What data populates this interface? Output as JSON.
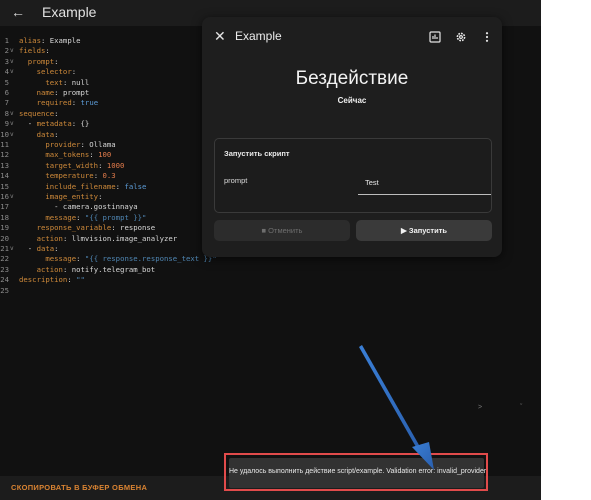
{
  "topbar": {
    "title": "Example",
    "back_icon": "arrow-left-icon"
  },
  "editor": {
    "lines": [
      {
        "num": "1",
        "fold": "",
        "parts": [
          {
            "c": "k",
            "t": "alias"
          },
          {
            "c": "v",
            "t": ": Example"
          }
        ]
      },
      {
        "num": "2",
        "fold": "v",
        "parts": [
          {
            "c": "k",
            "t": "fields"
          },
          {
            "c": "v",
            "t": ":"
          }
        ]
      },
      {
        "num": "3",
        "fold": "v",
        "parts": [
          {
            "c": "v",
            "t": "  "
          },
          {
            "c": "k",
            "t": "prompt"
          },
          {
            "c": "v",
            "t": ":"
          }
        ]
      },
      {
        "num": "4",
        "fold": "v",
        "parts": [
          {
            "c": "v",
            "t": "    "
          },
          {
            "c": "k",
            "t": "selector"
          },
          {
            "c": "v",
            "t": ":"
          }
        ]
      },
      {
        "num": "5",
        "fold": "",
        "parts": [
          {
            "c": "v",
            "t": "      "
          },
          {
            "c": "k",
            "t": "text"
          },
          {
            "c": "v",
            "t": ": null"
          }
        ]
      },
      {
        "num": "6",
        "fold": "",
        "parts": [
          {
            "c": "v",
            "t": "    "
          },
          {
            "c": "k",
            "t": "name"
          },
          {
            "c": "v",
            "t": ": prompt"
          }
        ]
      },
      {
        "num": "7",
        "fold": "",
        "parts": [
          {
            "c": "v",
            "t": "    "
          },
          {
            "c": "k",
            "t": "required"
          },
          {
            "c": "v",
            "t": ": "
          },
          {
            "c": "b",
            "t": "true"
          }
        ]
      },
      {
        "num": "8",
        "fold": "v",
        "parts": [
          {
            "c": "k",
            "t": "sequence"
          },
          {
            "c": "v",
            "t": ":"
          }
        ]
      },
      {
        "num": "9",
        "fold": "v",
        "parts": [
          {
            "c": "v",
            "t": "  - "
          },
          {
            "c": "k",
            "t": "metadata"
          },
          {
            "c": "v",
            "t": ": {}"
          }
        ]
      },
      {
        "num": "10",
        "fold": "v",
        "parts": [
          {
            "c": "v",
            "t": "    "
          },
          {
            "c": "k",
            "t": "data"
          },
          {
            "c": "v",
            "t": ":"
          }
        ]
      },
      {
        "num": "11",
        "fold": "",
        "parts": [
          {
            "c": "v",
            "t": "      "
          },
          {
            "c": "k",
            "t": "provider"
          },
          {
            "c": "v",
            "t": ": Ollama"
          }
        ]
      },
      {
        "num": "12",
        "fold": "",
        "parts": [
          {
            "c": "v",
            "t": "      "
          },
          {
            "c": "k",
            "t": "max_tokens"
          },
          {
            "c": "v",
            "t": ": "
          },
          {
            "c": "m",
            "t": "100"
          }
        ]
      },
      {
        "num": "13",
        "fold": "",
        "parts": [
          {
            "c": "v",
            "t": "      "
          },
          {
            "c": "k",
            "t": "target_width"
          },
          {
            "c": "v",
            "t": ": "
          },
          {
            "c": "m",
            "t": "1000"
          }
        ]
      },
      {
        "num": "14",
        "fold": "",
        "parts": [
          {
            "c": "v",
            "t": "      "
          },
          {
            "c": "k",
            "t": "temperature"
          },
          {
            "c": "v",
            "t": ": "
          },
          {
            "c": "m",
            "t": "0.3"
          }
        ]
      },
      {
        "num": "15",
        "fold": "",
        "parts": [
          {
            "c": "v",
            "t": "      "
          },
          {
            "c": "k",
            "t": "include_filename"
          },
          {
            "c": "v",
            "t": ": "
          },
          {
            "c": "b",
            "t": "false"
          }
        ]
      },
      {
        "num": "16",
        "fold": "v",
        "parts": [
          {
            "c": "v",
            "t": "      "
          },
          {
            "c": "k",
            "t": "image_entity"
          },
          {
            "c": "v",
            "t": ":"
          }
        ]
      },
      {
        "num": "17",
        "fold": "",
        "parts": [
          {
            "c": "v",
            "t": "        - camera.gostinnaya"
          }
        ]
      },
      {
        "num": "18",
        "fold": "",
        "parts": [
          {
            "c": "v",
            "t": "      "
          },
          {
            "c": "k",
            "t": "message"
          },
          {
            "c": "v",
            "t": ": "
          },
          {
            "c": "s",
            "t": "\"{{ prompt }}\""
          }
        ]
      },
      {
        "num": "19",
        "fold": "",
        "parts": [
          {
            "c": "v",
            "t": "    "
          },
          {
            "c": "k",
            "t": "response_variable"
          },
          {
            "c": "v",
            "t": ": response"
          }
        ]
      },
      {
        "num": "20",
        "fold": "",
        "parts": [
          {
            "c": "v",
            "t": "    "
          },
          {
            "c": "k",
            "t": "action"
          },
          {
            "c": "v",
            "t": ": llmvision.image_analyzer"
          }
        ]
      },
      {
        "num": "21",
        "fold": "v",
        "parts": [
          {
            "c": "v",
            "t": "  - "
          },
          {
            "c": "k",
            "t": "data"
          },
          {
            "c": "v",
            "t": ":"
          }
        ]
      },
      {
        "num": "22",
        "fold": "",
        "parts": [
          {
            "c": "v",
            "t": "      "
          },
          {
            "c": "k",
            "t": "message"
          },
          {
            "c": "v",
            "t": ": "
          },
          {
            "c": "s",
            "t": "\"{{ response.response_text }}\""
          }
        ]
      },
      {
        "num": "23",
        "fold": "",
        "parts": [
          {
            "c": "v",
            "t": "    "
          },
          {
            "c": "k",
            "t": "action"
          },
          {
            "c": "v",
            "t": ": notify.telegram_bot"
          }
        ]
      },
      {
        "num": "24",
        "fold": "",
        "parts": [
          {
            "c": "k",
            "t": "description"
          },
          {
            "c": "v",
            "t": ": "
          },
          {
            "c": "s",
            "t": "\"\""
          }
        ]
      },
      {
        "num": "25",
        "fold": "",
        "parts": []
      }
    ],
    "marks": [
      ">",
      "ˇ"
    ]
  },
  "footer": {
    "copy_label": "СКОПИРОВАТЬ В БУФЕР ОБМЕНА"
  },
  "dialog": {
    "title": "Example",
    "icons": [
      "chart-icon",
      "gear-icon",
      "more-vertical-icon"
    ],
    "state": "Бездействие",
    "state_time": "Сейчас",
    "card_title": "Запустить скрипт",
    "field_label": "prompt",
    "field_value": "Test",
    "cancel_label": "Отменить",
    "run_label": "Запустить"
  },
  "toast": {
    "text": "Не удалось выполнить действие script/example. Validation error: invalid_provider"
  },
  "colors": {
    "highlight": "#e14b4b",
    "arrow": "#2f6fc4",
    "key": "#cf8a3a",
    "accent": "#d98332"
  }
}
